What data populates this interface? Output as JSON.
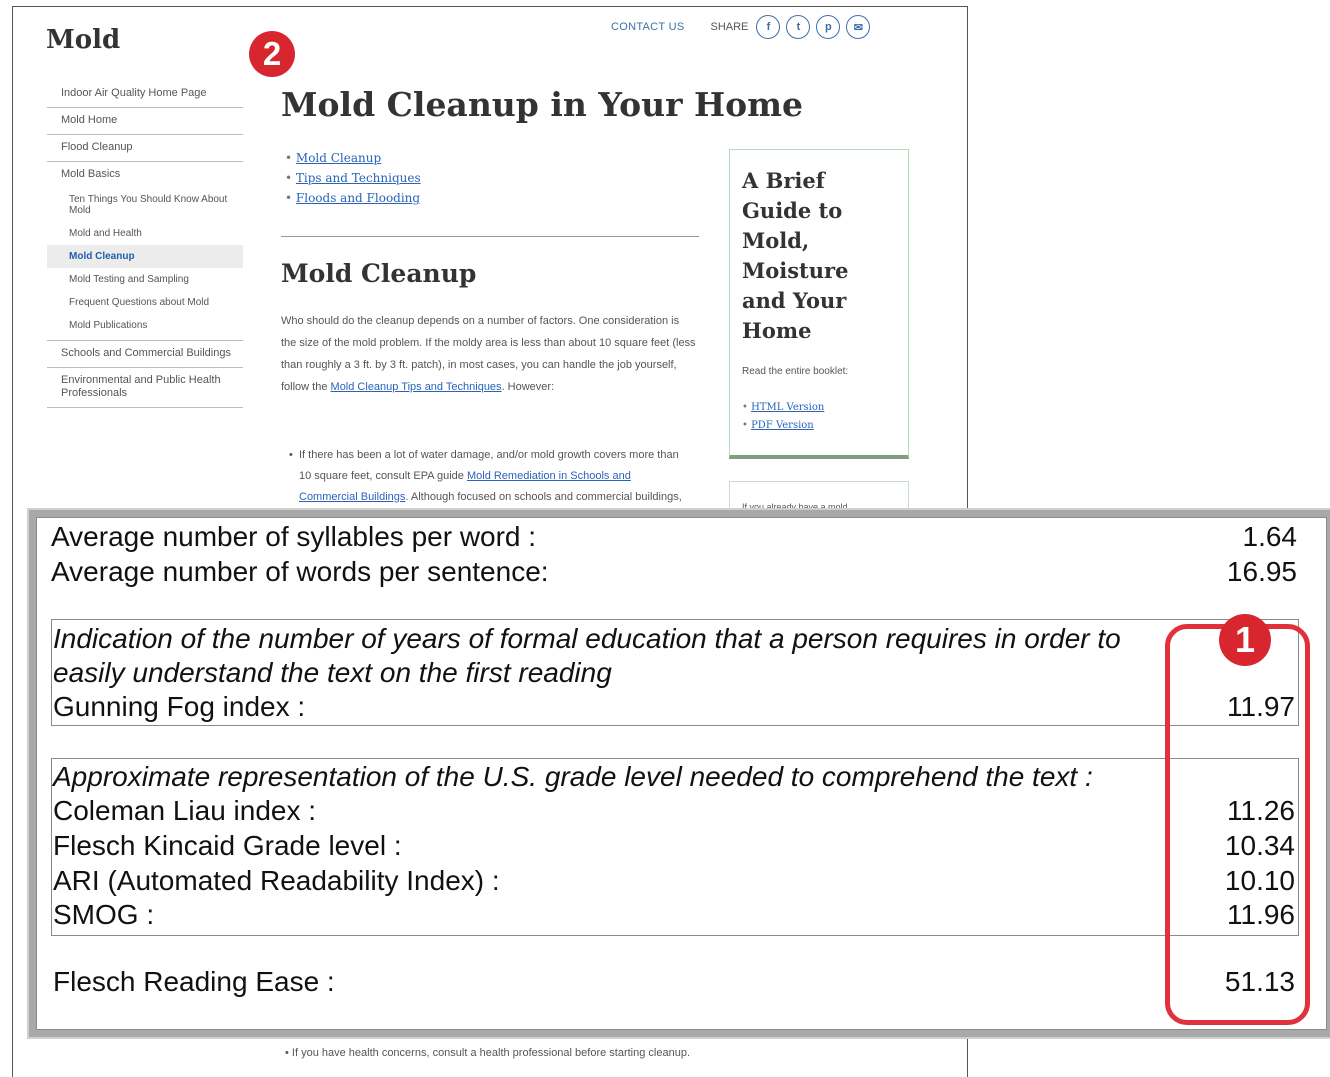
{
  "page": {
    "site_title": "Mold",
    "contact_us": "CONTACT US",
    "share_label": "SHARE",
    "share_icons": [
      "facebook-icon",
      "twitter-icon",
      "pinterest-icon",
      "email-icon"
    ],
    "sidebar": {
      "item_home": "Indoor Air Quality Home Page",
      "item_mold_home": "Mold Home",
      "item_flood": "Flood Cleanup",
      "item_basics": "Mold Basics",
      "sub_ten": "Ten Things You Should Know About Mold",
      "sub_health": "Mold and Health",
      "sub_cleanup": "Mold Cleanup",
      "sub_testing": "Mold Testing and Sampling",
      "sub_faq": "Frequent Questions about Mold",
      "sub_pubs": "Mold Publications",
      "item_schools": "Schools and Commercial Buildings",
      "item_env": "Environmental and Public Health Professionals"
    },
    "heading": "Mold Cleanup in Your Home",
    "toc": [
      "Mold Cleanup",
      "Tips and Techniques",
      "Floods and Flooding"
    ],
    "section_heading": "Mold Cleanup",
    "para_text": "Who should do the cleanup depends on a number of factors. One consideration is the size of the mold problem. If the moldy area is less than about 10 square feet (less than roughly a 3 ft. by 3 ft. patch), in most cases, you can handle the job yourself, follow the ",
    "para_link": "Mold Cleanup Tips and Techniques",
    "para_tail": ". However:",
    "bullet_text": "If there has been a lot of water damage, and/or mold growth covers more than 10 square feet, consult EPA guide ",
    "bullet_link": "Mold Remediation in Schools and Commercial Buildings",
    "bullet_tail": ". Although focused on schools and commercial buildings, this document is",
    "bottom_bullet": "If you have health concerns, consult a health professional before starting cleanup.",
    "guide": {
      "title": "A Brief Guide to Mold, Moisture and Your Home",
      "read": "Read the entire booklet:",
      "link_html": "HTML Version",
      "link_pdf": "PDF Version",
      "box2_text": "If you already have a mold"
    }
  },
  "readability": {
    "syllables_label": "Average number of syllables per word :",
    "syllables_value": "1.64",
    "words_label": "Average number of words per sentence:",
    "words_value": "16.95",
    "fog_note": "Indication of the number of years of formal education that a person requires in order to easily understand the text on the first reading",
    "fog_label": "Gunning Fog index :",
    "fog_value": "11.97",
    "grade_note": "Approximate representation of the U.S. grade level needed to comprehend the text :",
    "coleman_label": "Coleman Liau index :",
    "coleman_value": "11.26",
    "fk_label": "Flesch Kincaid Grade level :",
    "fk_value": "10.34",
    "ari_label": "ARI (Automated Readability Index) :",
    "ari_value": "10.10",
    "smog_label": "SMOG :",
    "smog_value": "11.96",
    "ease_label": "Flesch Reading Ease :",
    "ease_value": "51.13"
  },
  "callouts": {
    "badge_one": "1",
    "badge_two": "2"
  },
  "colors": {
    "callout_red": "#d8262e",
    "link_blue": "#2a63b8",
    "guide_border": "#b9d9b9"
  }
}
